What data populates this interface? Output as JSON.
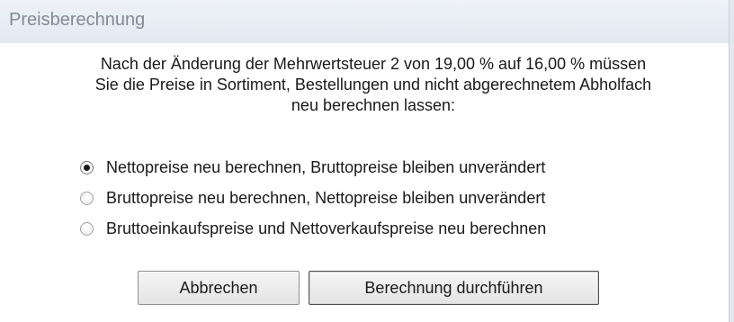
{
  "window": {
    "title": "Preisberechnung"
  },
  "message": {
    "lines": [
      "Nach der Änderung der Mehrwertsteuer 2 von 19,00 % auf 16,00 % müssen",
      "Sie die Preise in Sortiment, Bestellungen und nicht abgerechnetem Abholfach",
      "neu berechnen lassen:"
    ]
  },
  "options": [
    {
      "label": "Nettopreise neu berechnen, Bruttopreise bleiben unverändert",
      "selected": true
    },
    {
      "label": "Bruttopreise neu berechnen, Nettopreise bleiben unverändert",
      "selected": false
    },
    {
      "label": "Bruttoeinkaufspreise und Nettoverkaufspreise neu berechnen",
      "selected": false
    }
  ],
  "buttons": {
    "cancel_label": "Abbrechen",
    "ok_label": "Berechnung durchführen"
  }
}
